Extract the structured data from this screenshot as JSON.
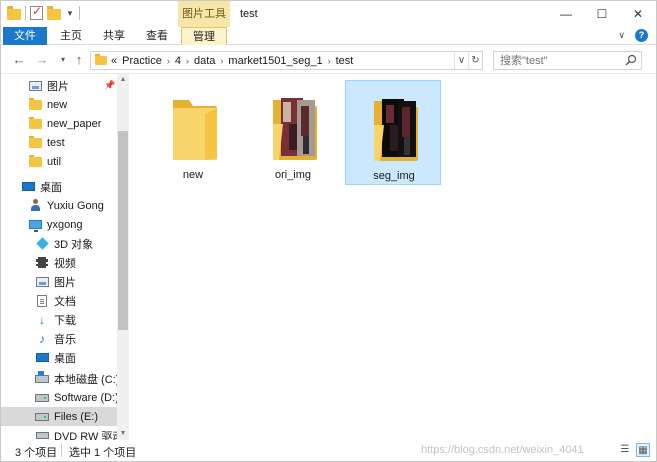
{
  "window": {
    "title": "test",
    "context_group": "图片工具",
    "controls": {
      "minimize": "—",
      "maximize": "☐",
      "close": "✕"
    }
  },
  "ribbon": {
    "tabs": [
      "文件",
      "主页",
      "共享",
      "查看",
      "管理"
    ],
    "active_color": "#1979ca"
  },
  "address": {
    "prefix": "«",
    "crumbs": [
      "Practice",
      "4",
      "data",
      "market1501_seg_1",
      "test"
    ],
    "separator": "›"
  },
  "search": {
    "placeholder": "搜索\"test\""
  },
  "nav": {
    "quick_access": [
      {
        "label": "图片",
        "icon": "pictures-icon",
        "pinned": true
      },
      {
        "label": "new",
        "icon": "folder-icon"
      },
      {
        "label": "new_paper",
        "icon": "folder-icon"
      },
      {
        "label": "test",
        "icon": "folder-icon"
      },
      {
        "label": "util",
        "icon": "folder-icon"
      }
    ],
    "desktop": "桌面",
    "user": "Yuxiu Gong",
    "pc": "yxgong",
    "pc_items": [
      {
        "label": "3D 对象",
        "icon": "3d-objects-icon"
      },
      {
        "label": "视频",
        "icon": "video-icon"
      },
      {
        "label": "图片",
        "icon": "pictures-icon"
      },
      {
        "label": "文档",
        "icon": "document-icon"
      },
      {
        "label": "下载",
        "icon": "download-icon"
      },
      {
        "label": "音乐",
        "icon": "music-icon"
      },
      {
        "label": "桌面",
        "icon": "desktop-icon"
      }
    ],
    "drives": [
      {
        "label": "本地磁盘 (C:)",
        "icon": "drive-icon"
      },
      {
        "label": "Software (D:)",
        "icon": "drive-icon"
      },
      {
        "label": "Files (E:)",
        "icon": "drive-icon",
        "selected": true
      },
      {
        "label": "DVD RW 驱动",
        "icon": "dvd-icon"
      }
    ]
  },
  "items": [
    {
      "name": "new",
      "type": "empty-folder",
      "selected": false
    },
    {
      "name": "ori_img",
      "type": "image-folder",
      "selected": false
    },
    {
      "name": "seg_img",
      "type": "image-folder",
      "selected": true
    }
  ],
  "status": {
    "count": "3 个项目",
    "selected": "选中 1 个项目",
    "watermark": "https://blog.csdn.net/weixin_4041"
  },
  "colors": {
    "folder": "#f5c542",
    "folder_dark": "#e6b12f",
    "selection": "#cce8ff",
    "selection_border": "#99d1ff"
  }
}
